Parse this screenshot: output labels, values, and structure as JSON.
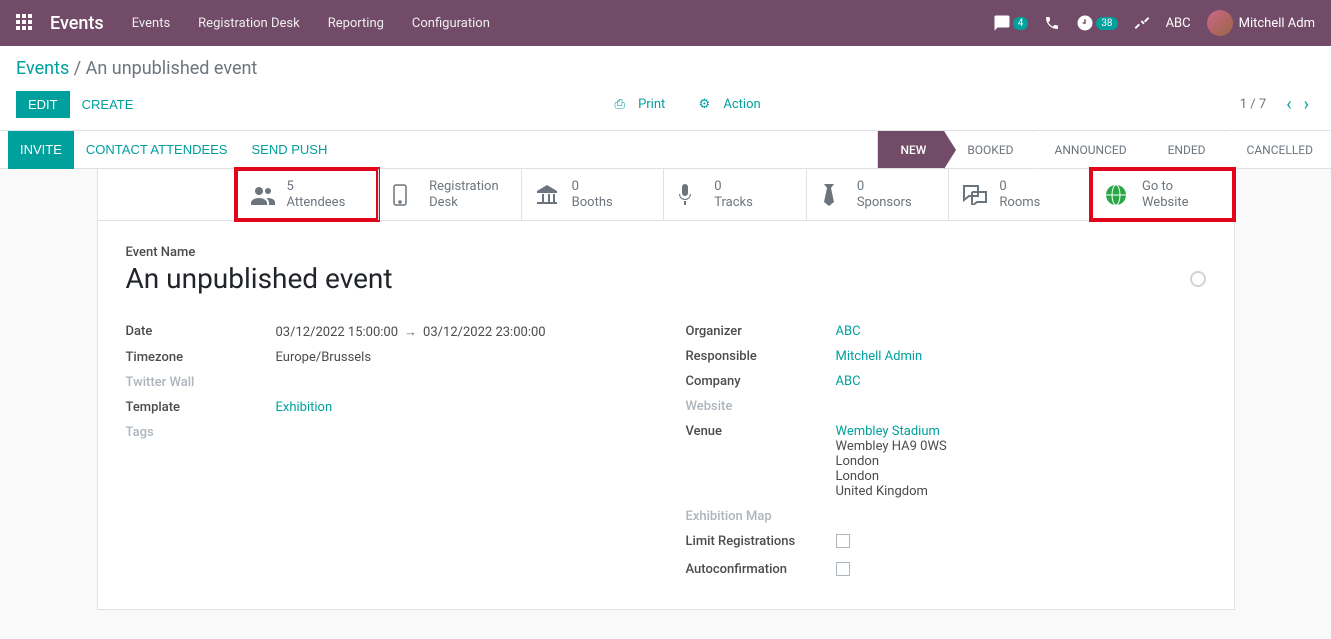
{
  "navbar": {
    "brand": "Events",
    "links": [
      "Events",
      "Registration Desk",
      "Reporting",
      "Configuration"
    ],
    "chat_badge": "4",
    "activity_badge": "38",
    "company": "ABC",
    "user": "Mitchell Adm"
  },
  "breadcrumb": {
    "root": "Events",
    "sep": " / ",
    "current": "An unpublished event"
  },
  "controlpanel": {
    "edit": "EDIT",
    "create": "CREATE",
    "print": "Print",
    "action": "Action",
    "pager": "1 / 7"
  },
  "statusrow": {
    "invite": "INVITE",
    "contact": "CONTACT ATTENDEES",
    "push": "SEND PUSH",
    "steps": [
      "NEW",
      "BOOKED",
      "ANNOUNCED",
      "ENDED",
      "CANCELLED"
    ]
  },
  "stats": {
    "attendees": {
      "value": "5",
      "label": "Attendees"
    },
    "regdesk": {
      "value": "",
      "label_top": "Registration",
      "label_bot": "Desk"
    },
    "booths": {
      "value": "0",
      "label": "Booths"
    },
    "tracks": {
      "value": "0",
      "label": "Tracks"
    },
    "sponsors": {
      "value": "0",
      "label": "Sponsors"
    },
    "rooms": {
      "value": "0",
      "label": "Rooms"
    },
    "website": {
      "value": "",
      "label_top": "Go to",
      "label_bot": "Website"
    }
  },
  "form": {
    "name_label": "Event Name",
    "name": "An unpublished event",
    "left": {
      "date_label": "Date",
      "date_start": "03/12/2022 15:00:00",
      "date_end": "03/12/2022 23:00:00",
      "tz_label": "Timezone",
      "tz": "Europe/Brussels",
      "twitter_label": "Twitter Wall",
      "twitter": "",
      "template_label": "Template",
      "template": "Exhibition",
      "tags_label": "Tags",
      "tags": ""
    },
    "right": {
      "organizer_label": "Organizer",
      "organizer": "ABC",
      "responsible_label": "Responsible",
      "responsible": "Mitchell Admin",
      "company_label": "Company",
      "company": "ABC",
      "website_label": "Website",
      "website": "",
      "venue_label": "Venue",
      "venue_name": "Wembley Stadium",
      "venue_addr1": "Wembley HA9 0WS",
      "venue_city": "London",
      "venue_city2": "London",
      "venue_country": "United Kingdom",
      "exhibition_map_label": "Exhibition Map",
      "limit_label": "Limit Registrations",
      "autoconfirm_label": "Autoconfirmation"
    }
  }
}
